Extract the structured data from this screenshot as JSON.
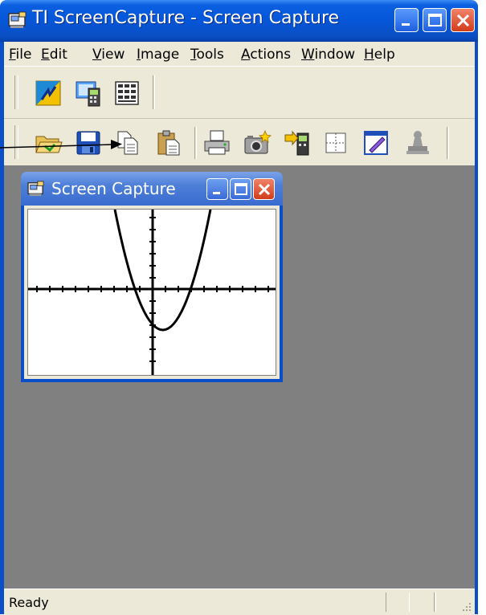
{
  "app": {
    "title": "TI ScreenCapture - Screen Capture"
  },
  "menu": {
    "items": [
      {
        "key": "F",
        "rest": "ile"
      },
      {
        "key": "E",
        "rest": "dit"
      },
      {
        "key": "V",
        "rest": "iew"
      },
      {
        "key": "I",
        "rest": "mage"
      },
      {
        "key": "T",
        "rest": "ools"
      },
      {
        "key": "A",
        "rest": "ctions"
      },
      {
        "key": "W",
        "rest": "indow"
      },
      {
        "key": "H",
        "rest": "elp"
      }
    ]
  },
  "toolbar_row1": [
    "ti-connect-icon",
    "capture-calculator-icon",
    "capture-all-icon"
  ],
  "toolbar_row2": [
    "open-folder-icon",
    "save-icon",
    "copy-icon",
    "paste-icon",
    "print-icon",
    "camera-icon",
    "send-to-device-icon",
    "grid-icon",
    "edit-icon",
    "stamp-icon"
  ],
  "child_window": {
    "title": "Screen Capture"
  },
  "status": {
    "text": "Ready"
  },
  "colors": {
    "title_blue": "#0556d8",
    "client_gray": "#808080",
    "chrome": "#ece9d8",
    "close_red": "#d23c1a"
  }
}
